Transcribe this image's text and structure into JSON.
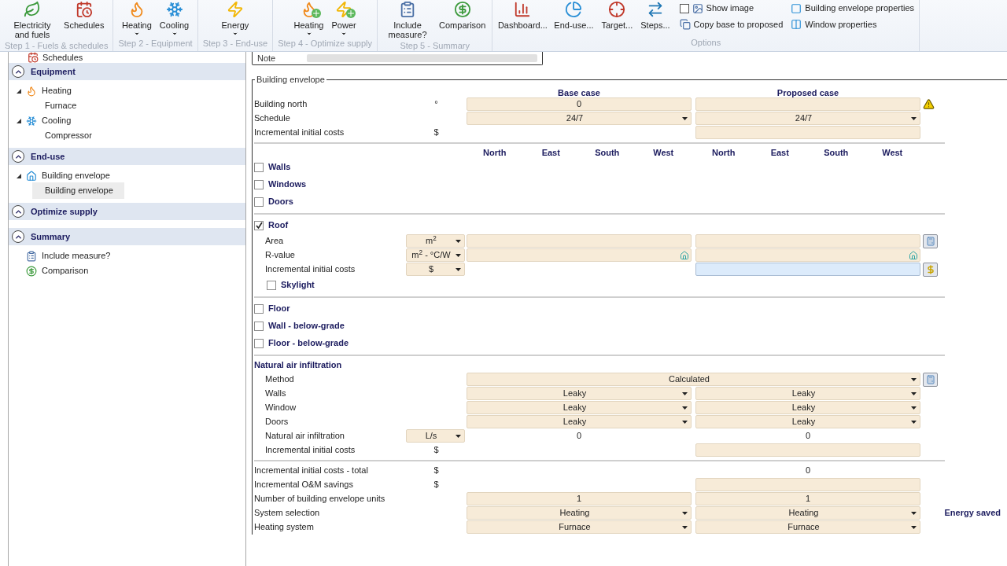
{
  "ribbon": {
    "groups": [
      {
        "label": "Step 1 - Fuels & schedules",
        "buttons": [
          {
            "label": "Electricity and fuels",
            "kind": "fuels",
            "dropdown": false
          },
          {
            "label": "Schedules",
            "kind": "schedules",
            "dropdown": false
          }
        ]
      },
      {
        "label": "Step 2 - Equipment",
        "buttons": [
          {
            "label": "Heating",
            "kind": "heating",
            "dropdown": true
          },
          {
            "label": "Cooling",
            "kind": "cooling",
            "dropdown": true
          }
        ]
      },
      {
        "label": "Step 3 - End-use",
        "buttons": [
          {
            "label": "Energy",
            "kind": "energy",
            "dropdown": true
          }
        ]
      },
      {
        "label": "Step 4 - Optimize supply",
        "buttons": [
          {
            "label": "Heating",
            "kind": "heating-plus",
            "dropdown": true
          },
          {
            "label": "Power",
            "kind": "power-plus",
            "dropdown": true
          }
        ]
      },
      {
        "label": "Step 5 - Summary",
        "buttons": [
          {
            "label": "Include measure?",
            "kind": "measure",
            "dropdown": false
          },
          {
            "label": "Comparison",
            "kind": "comparison",
            "dropdown": false
          }
        ]
      },
      {
        "label": "Options",
        "buttons": [
          {
            "label": "Dashboard...",
            "kind": "dashboard",
            "dropdown": false
          },
          {
            "label": "End-use...",
            "kind": "end-use",
            "dropdown": false
          },
          {
            "label": "Target...",
            "kind": "target",
            "dropdown": false
          },
          {
            "label": "Steps...",
            "kind": "steps",
            "dropdown": false
          }
        ],
        "columns": [
          [
            {
              "label": "Show image",
              "kind": "checkbox",
              "checked": false
            },
            {
              "label": "Copy base to proposed",
              "kind": "copy"
            }
          ],
          [
            {
              "label": "Building envelope properties",
              "kind": "envelope"
            },
            {
              "label": "Window properties",
              "kind": "window"
            }
          ]
        ]
      }
    ]
  },
  "sidebar": {
    "top_items": [
      {
        "label": "Schedules",
        "kind": "schedules"
      }
    ],
    "sections": [
      {
        "title": "Equipment",
        "expanded": true,
        "items": [
          {
            "label": "Heating",
            "kind": "heating",
            "expanded": true,
            "children": [
              {
                "label": "Furnace",
                "selected": false
              }
            ]
          },
          {
            "label": "Cooling",
            "kind": "cooling",
            "expanded": true,
            "children": [
              {
                "label": "Compressor",
                "selected": false
              }
            ]
          }
        ]
      },
      {
        "title": "End-use",
        "expanded": true,
        "items": [
          {
            "label": "Building envelope",
            "kind": "envelope",
            "expanded": true,
            "children": [
              {
                "label": "Building envelope",
                "selected": true
              }
            ]
          }
        ]
      },
      {
        "title": "Optimize supply",
        "expanded": true
      },
      {
        "title": "Summary",
        "expanded": true,
        "items": [
          {
            "label": "Include measure?",
            "kind": "measure"
          },
          {
            "label": "Comparison",
            "kind": "comparison"
          }
        ]
      }
    ]
  },
  "note": {
    "label": "Note"
  },
  "envelope": {
    "title": "Building envelope",
    "base_header": "Base case",
    "proposed_header": "Proposed case",
    "groups": [
      {
        "items": [
          {
            "kind": "row",
            "label": "Building north",
            "unit": {
              "kind": "text",
              "value": "°"
            },
            "base": {
              "kind": "field",
              "value": "0"
            },
            "proposed": {
              "kind": "field"
            },
            "side": {
              "kind": "warning"
            }
          },
          {
            "kind": "row",
            "label": "Schedule",
            "base": {
              "kind": "dropdown",
              "value": "24/7"
            },
            "proposed": {
              "kind": "dropdown",
              "value": "24/7"
            }
          },
          {
            "kind": "row",
            "label": "Incremental initial costs",
            "unit": {
              "kind": "text",
              "value": "$"
            },
            "proposed": {
              "kind": "field"
            }
          }
        ]
      },
      {
        "compass": {
          "base": [
            "North",
            "East",
            "South",
            "West"
          ],
          "proposed": [
            "North",
            "East",
            "South",
            "West"
          ]
        },
        "items": [
          {
            "kind": "checkbox",
            "label": "Walls",
            "checked": false
          },
          {
            "kind": "checkbox",
            "label": "Windows",
            "checked": false
          },
          {
            "kind": "checkbox",
            "label": "Doors",
            "checked": false
          }
        ]
      },
      {
        "items": [
          {
            "kind": "checkbox",
            "label": "Roof",
            "checked": true,
            "children": [
              {
                "kind": "row",
                "label": "Area",
                "unit": {
                  "kind": "dropdown",
                  "value": "m$^{2}$"
                },
                "base": {
                  "kind": "field"
                },
                "proposed": {
                  "kind": "field"
                },
                "side": {
                  "kind": "calculator"
                }
              },
              {
                "kind": "row",
                "label": "R-value",
                "unit": {
                  "kind": "dropdown",
                  "value": "m$^{2}$ - °C/W"
                },
                "base": {
                  "kind": "field",
                  "default_marker": true
                },
                "proposed": {
                  "kind": "field",
                  "default_marker": true
                }
              },
              {
                "kind": "row",
                "label": "Incremental initial costs",
                "unit": {
                  "kind": "dropdown",
                  "value": "$"
                },
                "proposed": {
                  "kind": "active"
                },
                "side": {
                  "kind": "cost"
                }
              },
              {
                "kind": "checkbox",
                "label": "Skylight",
                "checked": false
              }
            ]
          }
        ]
      },
      {
        "items": [
          {
            "kind": "checkbox",
            "label": "Floor",
            "checked": false
          },
          {
            "kind": "checkbox",
            "label": "Wall - below-grade",
            "checked": false
          },
          {
            "kind": "checkbox",
            "label": "Floor - below-grade",
            "checked": false
          }
        ]
      },
      {
        "items": [
          {
            "kind": "heading",
            "label": "Natural air infiltration",
            "children": [
              {
                "kind": "row",
                "label": "Method",
                "both": {
                  "kind": "dropdown",
                  "value": "Calculated"
                },
                "side": {
                  "kind": "calculator"
                }
              },
              {
                "kind": "row",
                "label": "Walls",
                "base": {
                  "kind": "dropdown",
                  "value": "Leaky"
                },
                "proposed": {
                  "kind": "dropdown",
                  "value": "Leaky"
                }
              },
              {
                "kind": "row",
                "label": "Window",
                "base": {
                  "kind": "dropdown",
                  "value": "Leaky"
                },
                "proposed": {
                  "kind": "dropdown",
                  "value": "Leaky"
                }
              },
              {
                "kind": "row",
                "label": "Doors",
                "base": {
                  "kind": "dropdown",
                  "value": "Leaky"
                },
                "proposed": {
                  "kind": "dropdown",
                  "value": "Leaky"
                }
              },
              {
                "kind": "row",
                "label": "Natural air infiltration",
                "unit": {
                  "kind": "dropdown",
                  "value": "L/s"
                },
                "base": {
                  "kind": "text",
                  "value": "0"
                },
                "proposed": {
                  "kind": "text",
                  "value": "0"
                }
              },
              {
                "kind": "row",
                "label": "Incremental initial costs",
                "unit": {
                  "kind": "text",
                  "value": "$"
                },
                "proposed": {
                  "kind": "field"
                }
              }
            ]
          }
        ]
      },
      {
        "items": [
          {
            "kind": "row",
            "label": "Incremental initial costs - total",
            "unit": {
              "kind": "text",
              "value": "$"
            },
            "proposed": {
              "kind": "text",
              "value": "0"
            }
          },
          {
            "kind": "row",
            "label": "Incremental O&M savings",
            "unit": {
              "kind": "text",
              "value": "$"
            },
            "proposed": {
              "kind": "field"
            }
          },
          {
            "kind": "row",
            "label": "Number of building envelope units",
            "base": {
              "kind": "field",
              "value": "1"
            },
            "proposed": {
              "kind": "field",
              "value": "1"
            }
          },
          {
            "kind": "row",
            "label": "System selection",
            "base": {
              "kind": "dropdown",
              "value": "Heating"
            },
            "proposed": {
              "kind": "dropdown",
              "value": "Heating"
            },
            "aside": "Energy saved"
          },
          {
            "kind": "row",
            "label": "Heating system",
            "base": {
              "kind": "dropdown",
              "value": "Furnace"
            },
            "proposed": {
              "kind": "dropdown",
              "value": "Furnace"
            }
          }
        ]
      }
    ]
  }
}
